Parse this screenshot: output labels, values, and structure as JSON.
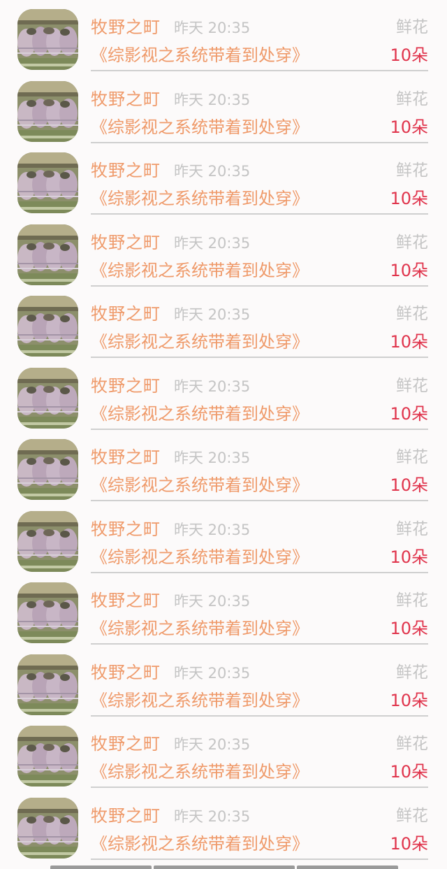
{
  "records": [
    {
      "user": "牧野之町",
      "time": "昨天 20:35",
      "gift": "鲜花",
      "title": "《综影视之系统带着到处穿》",
      "count": "10朵"
    },
    {
      "user": "牧野之町",
      "time": "昨天 20:35",
      "gift": "鲜花",
      "title": "《综影视之系统带着到处穿》",
      "count": "10朵"
    },
    {
      "user": "牧野之町",
      "time": "昨天 20:35",
      "gift": "鲜花",
      "title": "《综影视之系统带着到处穿》",
      "count": "10朵"
    },
    {
      "user": "牧野之町",
      "time": "昨天 20:35",
      "gift": "鲜花",
      "title": "《综影视之系统带着到处穿》",
      "count": "10朵"
    },
    {
      "user": "牧野之町",
      "time": "昨天 20:35",
      "gift": "鲜花",
      "title": "《综影视之系统带着到处穿》",
      "count": "10朵"
    },
    {
      "user": "牧野之町",
      "time": "昨天 20:35",
      "gift": "鲜花",
      "title": "《综影视之系统带着到处穿》",
      "count": "10朵"
    },
    {
      "user": "牧野之町",
      "time": "昨天 20:35",
      "gift": "鲜花",
      "title": "《综影视之系统带着到处穿》",
      "count": "10朵"
    },
    {
      "user": "牧野之町",
      "time": "昨天 20:35",
      "gift": "鲜花",
      "title": "《综影视之系统带着到处穿》",
      "count": "10朵"
    },
    {
      "user": "牧野之町",
      "time": "昨天 20:35",
      "gift": "鲜花",
      "title": "《综影视之系统带着到处穿》",
      "count": "10朵"
    },
    {
      "user": "牧野之町",
      "time": "昨天 20:35",
      "gift": "鲜花",
      "title": "《综影视之系统带着到处穿》",
      "count": "10朵"
    },
    {
      "user": "牧野之町",
      "time": "昨天 20:35",
      "gift": "鲜花",
      "title": "《综影视之系统带着到处穿》",
      "count": "10朵"
    },
    {
      "user": "牧野之町",
      "time": "昨天 20:35",
      "gift": "鲜花",
      "title": "《综影视之系统带着到处穿》",
      "count": "10朵"
    }
  ],
  "colors": {
    "accent_orange": "#ef9a6a",
    "count_red": "#e0344c",
    "muted_gray": "#c4c4c4",
    "background": "#fcfafa"
  },
  "icons": {
    "avatar": "cats-photo-avatar"
  }
}
